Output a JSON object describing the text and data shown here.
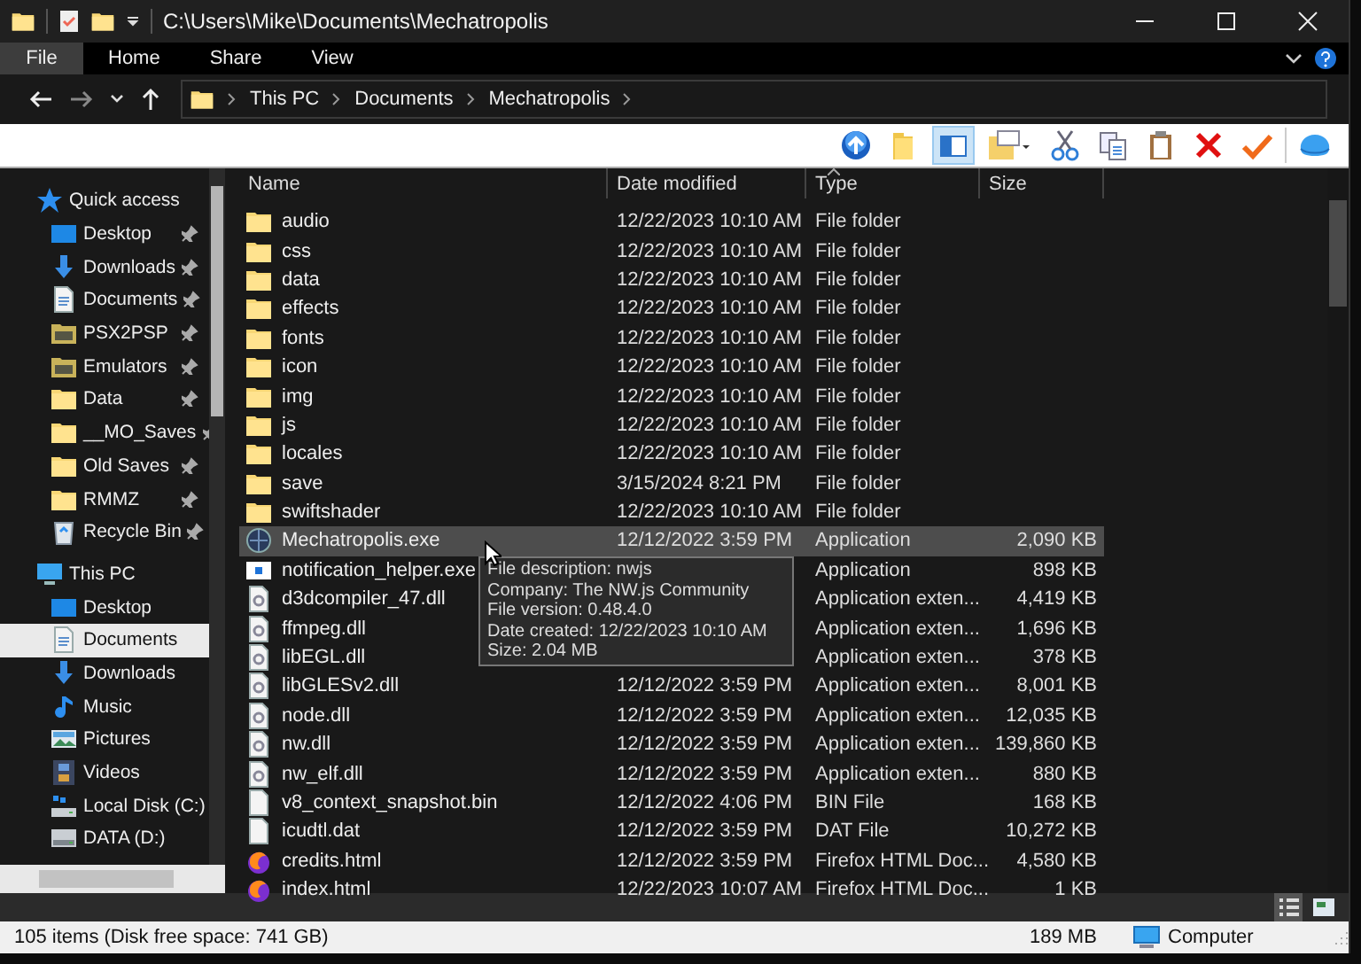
{
  "window": {
    "title": "C:\\Users\\Mike\\Documents\\Mechatropolis"
  },
  "ribbon_tabs": [
    {
      "label": "File",
      "selected": true
    },
    {
      "label": "Home",
      "selected": false
    },
    {
      "label": "Share",
      "selected": false
    },
    {
      "label": "View",
      "selected": false
    }
  ],
  "address_bar": {
    "crumbs": [
      "This PC",
      "Documents",
      "Mechatropolis"
    ]
  },
  "toolbar": [
    {
      "kind": "up",
      "selected": false
    },
    {
      "kind": "folder",
      "selected": false
    },
    {
      "kind": "pane",
      "selected": true
    },
    {
      "kind": "newfolder",
      "selected": false
    },
    {
      "kind": "cut",
      "selected": false
    },
    {
      "kind": "copy",
      "selected": false
    },
    {
      "kind": "paste",
      "selected": false
    },
    {
      "kind": "delete",
      "selected": false
    },
    {
      "kind": "check",
      "selected": false
    },
    {
      "kind": "shell",
      "selected": false
    }
  ],
  "navigation": [
    {
      "label": "Quick access",
      "kind": "star",
      "selected": false,
      "children": [
        {
          "label": "Desktop",
          "kind": "desktop",
          "pinned": true,
          "selected": false
        },
        {
          "label": "Downloads",
          "kind": "downloads",
          "pinned": true,
          "selected": false
        },
        {
          "label": "Documents",
          "kind": "documents",
          "pinned": true,
          "selected": false
        },
        {
          "label": "PSX2PSP",
          "kind": "special",
          "pinned": true,
          "selected": false
        },
        {
          "label": "Emulators",
          "kind": "special",
          "pinned": true,
          "selected": false
        },
        {
          "label": "Data",
          "kind": "folder",
          "pinned": true,
          "selected": false
        },
        {
          "label": "__MO_Saves",
          "kind": "folder",
          "pinned": true,
          "selected": false
        },
        {
          "label": "Old Saves",
          "kind": "folder",
          "pinned": true,
          "selected": false
        },
        {
          "label": "RMMZ",
          "kind": "folder",
          "pinned": true,
          "selected": false
        },
        {
          "label": "Recycle Bin",
          "kind": "recycle",
          "pinned": true,
          "selected": false
        }
      ]
    },
    {
      "label": "This PC",
      "kind": "pc",
      "selected": false,
      "children": [
        {
          "label": "Desktop",
          "kind": "desktop",
          "pinned": false,
          "selected": false
        },
        {
          "label": "Documents",
          "kind": "documents",
          "pinned": false,
          "selected": true
        },
        {
          "label": "Downloads",
          "kind": "downloads",
          "pinned": false,
          "selected": false
        },
        {
          "label": "Music",
          "kind": "music",
          "pinned": false,
          "selected": false
        },
        {
          "label": "Pictures",
          "kind": "pictures",
          "pinned": false,
          "selected": false
        },
        {
          "label": "Videos",
          "kind": "videos",
          "pinned": false,
          "selected": false
        },
        {
          "label": "Local Disk (C:)",
          "kind": "system_drive",
          "pinned": false,
          "selected": false
        },
        {
          "label": "DATA (D:)",
          "kind": "drive",
          "pinned": false,
          "selected": false
        }
      ]
    }
  ],
  "columns": [
    {
      "label": "Name",
      "sorted": false
    },
    {
      "label": "Date modified",
      "sorted": false
    },
    {
      "label": "Type",
      "sorted": true
    },
    {
      "label": "Size",
      "sorted": false
    }
  ],
  "files": [
    {
      "name": "audio",
      "date": "12/22/2023 10:10 AM",
      "type": "File folder",
      "kind": "folder",
      "selected": false
    },
    {
      "name": "css",
      "date": "12/22/2023 10:10 AM",
      "type": "File folder",
      "kind": "folder",
      "selected": false
    },
    {
      "name": "data",
      "date": "12/22/2023 10:10 AM",
      "type": "File folder",
      "kind": "folder",
      "selected": false
    },
    {
      "name": "effects",
      "date": "12/22/2023 10:10 AM",
      "type": "File folder",
      "kind": "folder",
      "selected": false
    },
    {
      "name": "fonts",
      "date": "12/22/2023 10:10 AM",
      "type": "File folder",
      "kind": "folder",
      "selected": false
    },
    {
      "name": "icon",
      "date": "12/22/2023 10:10 AM",
      "type": "File folder",
      "kind": "folder",
      "selected": false
    },
    {
      "name": "img",
      "date": "12/22/2023 10:10 AM",
      "type": "File folder",
      "kind": "folder",
      "selected": false
    },
    {
      "name": "js",
      "date": "12/22/2023 10:10 AM",
      "type": "File folder",
      "kind": "folder",
      "selected": false
    },
    {
      "name": "locales",
      "date": "12/22/2023 10:10 AM",
      "type": "File folder",
      "kind": "folder",
      "selected": false
    },
    {
      "name": "save",
      "date": "3/15/2024 8:21 PM",
      "type": "File folder",
      "kind": "folder",
      "selected": false
    },
    {
      "name": "swiftshader",
      "date": "12/22/2023 10:10 AM",
      "type": "File folder",
      "kind": "folder",
      "selected": false
    },
    {
      "name": "Mechatropolis.exe",
      "date": "12/12/2022 3:59 PM",
      "type": "Application",
      "size": "2,090 KB",
      "kind": "exe",
      "selected": true
    },
    {
      "name": "notification_helper.exe",
      "type": "Application",
      "size": "898 KB",
      "kind": "app",
      "selected": false
    },
    {
      "name": "d3dcompiler_47.dll",
      "type": "Application exten...",
      "size": "4,419 KB",
      "kind": "dll",
      "selected": false
    },
    {
      "name": "ffmpeg.dll",
      "type": "Application exten...",
      "size": "1,696 KB",
      "kind": "dll",
      "selected": false
    },
    {
      "name": "libEGL.dll",
      "type": "Application exten...",
      "size": "378 KB",
      "kind": "dll",
      "selected": false
    },
    {
      "name": "libGLESv2.dll",
      "date": "12/12/2022 3:59 PM",
      "type": "Application exten...",
      "size": "8,001 KB",
      "kind": "dll",
      "selected": false
    },
    {
      "name": "node.dll",
      "date": "12/12/2022 3:59 PM",
      "type": "Application exten...",
      "size": "12,035 KB",
      "kind": "dll",
      "selected": false
    },
    {
      "name": "nw.dll",
      "date": "12/12/2022 3:59 PM",
      "type": "Application exten...",
      "size": "139,860 KB",
      "kind": "dll",
      "selected": false
    },
    {
      "name": "nw_elf.dll",
      "date": "12/12/2022 3:59 PM",
      "type": "Application exten...",
      "size": "880 KB",
      "kind": "dll",
      "selected": false
    },
    {
      "name": "v8_context_snapshot.bin",
      "date": "12/12/2022 4:06 PM",
      "type": "BIN File",
      "size": "168 KB",
      "kind": "file",
      "selected": false
    },
    {
      "name": "icudtl.dat",
      "date": "12/12/2022 3:59 PM",
      "type": "DAT File",
      "size": "10,272 KB",
      "kind": "file",
      "selected": false
    },
    {
      "name": "credits.html",
      "date": "12/12/2022 3:59 PM",
      "type": "Firefox HTML Doc...",
      "size": "4,580 KB",
      "kind": "html",
      "selected": false
    },
    {
      "name": "index.html",
      "date": "12/22/2023 10:07 AM",
      "type": "Firefox HTML Doc...",
      "size": "1 KB",
      "kind": "html",
      "selected": false
    }
  ],
  "tooltip": [
    "File description: nwjs",
    "Company: The NW.js Community",
    "File version: 0.48.4.0",
    "Date created: 12/22/2023 10:10 AM",
    "Size: 2.04 MB"
  ],
  "status_bar": {
    "summary": "105 items (Disk free space: 741 GB)",
    "selection_size": "189 MB",
    "location": "Computer"
  }
}
